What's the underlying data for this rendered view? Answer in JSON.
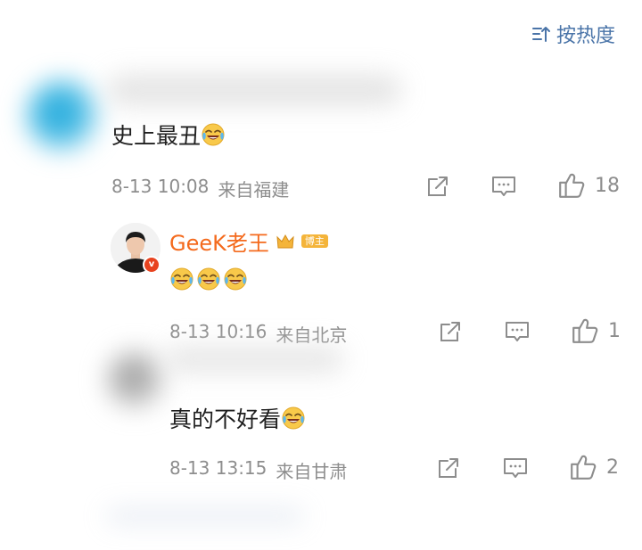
{
  "sort": {
    "label": "按热度"
  },
  "comments": [
    {
      "text": "史上最丑",
      "time": "8-13 10:08",
      "location": "来自福建",
      "likes": "18"
    },
    {
      "author": "GeeK老王",
      "badge": "博主",
      "time": "8-13 10:16",
      "location": "来自北京",
      "likes": "1"
    },
    {
      "text": "真的不好看",
      "time": "8-13 13:15",
      "location": "来自甘肃",
      "likes": "2"
    }
  ],
  "icons": {
    "sort": "sort-icon",
    "share": "share-icon",
    "reply": "comment-icon",
    "like": "thumbs-up-icon",
    "emoji": "laugh-cry-emoji-icon",
    "verified": "verified-v-icon"
  },
  "colors": {
    "accent_blue": "#4a74a8",
    "author_orange": "#f46a1d",
    "meta_gray": "#8d8d8d",
    "badge_gold": "#f4b43a"
  }
}
